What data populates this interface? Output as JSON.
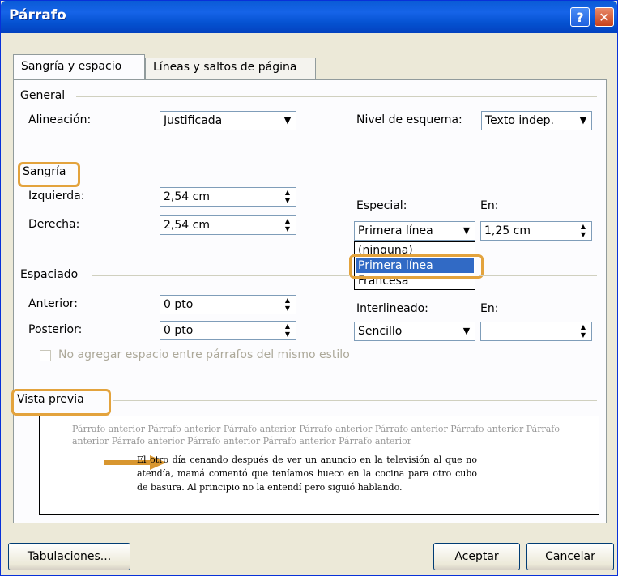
{
  "window": {
    "title": "Párrafo",
    "help_label": "?",
    "close_label": "✕"
  },
  "tabs": [
    {
      "label": "Sangría y espacio"
    },
    {
      "label": "Líneas y saltos de página"
    }
  ],
  "general": {
    "heading": "General",
    "alineacion_label": "Alineación:",
    "alineacion_value": "Justificada",
    "nivel_label": "Nivel de esquema:",
    "nivel_value": "Texto indep."
  },
  "sangria": {
    "heading": "Sangría",
    "izquierda_label": "Izquierda:",
    "izquierda_value": "2,54 cm",
    "derecha_label": "Derecha:",
    "derecha_value": "2,54 cm",
    "especial_label": "Especial:",
    "especial_value": "Primera línea",
    "en_label": "En:",
    "en_value": "1,25 cm",
    "especial_options": [
      "(ninguna)",
      "Primera línea",
      "Francesa"
    ]
  },
  "espaciado": {
    "heading": "Espaciado",
    "anterior_label": "Anterior:",
    "anterior_value": "0 pto",
    "posterior_label": "Posterior:",
    "posterior_value": "0 pto",
    "interlineado_label": "Interlineado:",
    "interlineado_value": "Sencillo",
    "en_label": "En:",
    "en_value": "",
    "no_agregar_label": "No agregar espacio entre párrafos del mismo estilo"
  },
  "vista_previa": {
    "heading": "Vista previa",
    "previous_text": "Párrafo anterior Párrafo anterior Párrafo anterior Párrafo anterior Párrafo anterior Párrafo anterior Párrafo anterior Párrafo anterior Párrafo anterior Párrafo anterior Párrafo anterior",
    "sample_text": "El otro día cenando después de ver un anuncio en la televisión al que no atendía, mamá comentó que teníamos hueco en la cocina para otro cubo de basura. Al principio no la entendí pero siguió hablando."
  },
  "footer": {
    "tabulaciones_label": "Tabulaciones...",
    "aceptar_label": "Aceptar",
    "cancelar_label": "Cancelar"
  },
  "colors": {
    "highlight": "#e3a33d",
    "selection": "#316ac5",
    "titlebar": "#0451d0"
  }
}
